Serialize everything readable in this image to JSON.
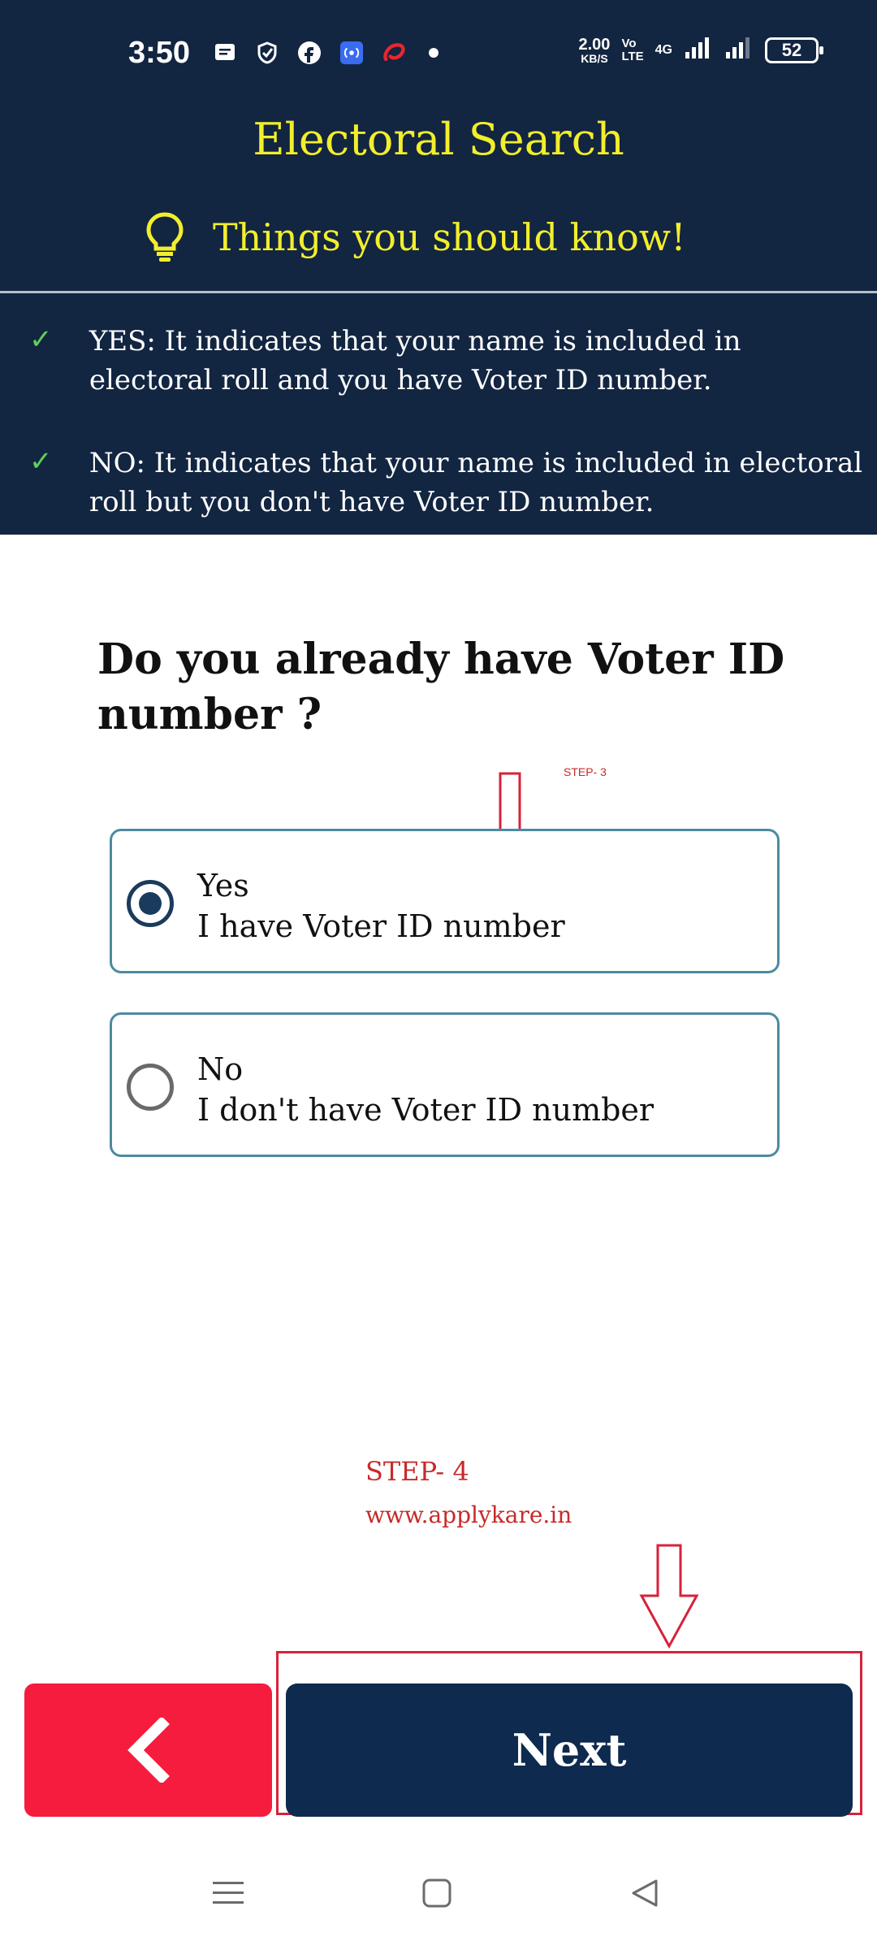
{
  "status_bar": {
    "time": "3:50",
    "speed_value": "2.00",
    "speed_unit": "KB/S",
    "volte_top": "Vo",
    "volte_bottom": "LTE",
    "network": "4G",
    "battery": "52"
  },
  "header": {
    "title": "Electoral Search",
    "subtitle": "Things you should know!",
    "info": [
      "YES: It indicates that your name is included in electoral roll and you have Voter ID number.",
      "NO: It indicates that your name is included in electoral roll but you don't have Voter ID number."
    ]
  },
  "question": "Do you already have Voter ID number ?",
  "options": [
    {
      "title": "Yes",
      "description": "I have Voter ID number",
      "selected": true
    },
    {
      "title": "No",
      "description": "I don't have Voter ID number",
      "selected": false
    }
  ],
  "annotations": {
    "step3": "STEP- 3",
    "step4": "STEP- 4",
    "site": "www.applykare.in",
    "color": "#c82a2a"
  },
  "buttons": {
    "back_icon": "chevron-left-icon",
    "next": "Next",
    "next_color": "#0e2a4e",
    "back_color": "#f51c3d"
  },
  "colors": {
    "header_bg": "#122541",
    "title_yellow": "#f2ee2c",
    "check_green": "#5fcf5a",
    "option_border": "#4d8aa0"
  }
}
